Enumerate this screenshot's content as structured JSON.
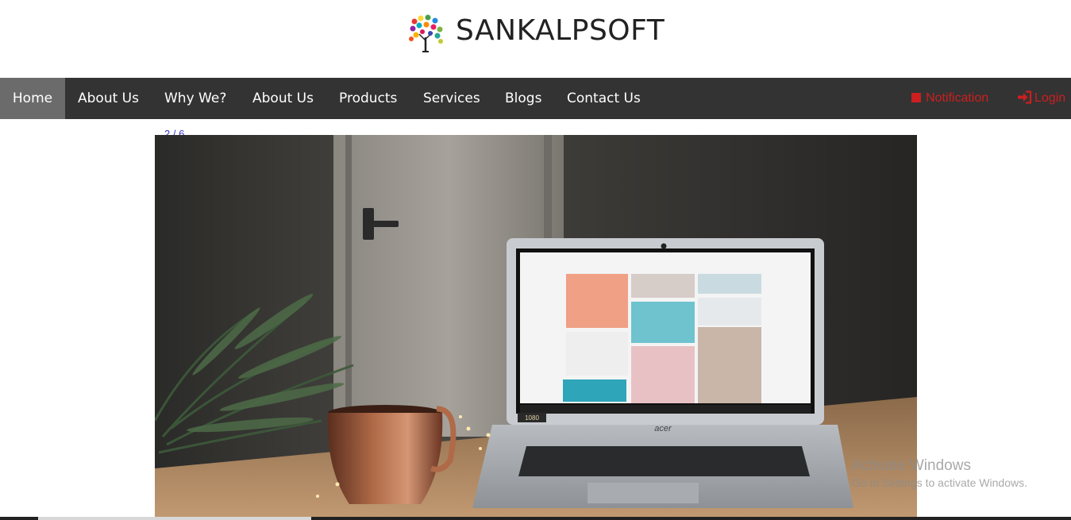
{
  "brand": {
    "name": "SANKALPSOFT",
    "logo_icon": "colorful-tree-icon"
  },
  "nav": {
    "items": [
      {
        "label": "Home",
        "active": true
      },
      {
        "label": "About Us"
      },
      {
        "label": "Why We?"
      },
      {
        "label": "About Us"
      },
      {
        "label": "Products"
      },
      {
        "label": "Services"
      },
      {
        "label": "Blogs"
      },
      {
        "label": "Contact Us"
      }
    ],
    "notification": {
      "label": "Notification",
      "icon": "square-icon"
    },
    "login": {
      "label": "Login",
      "icon": "sign-in-icon"
    },
    "accent_color": "#cc1f1f",
    "bar_color": "#333333"
  },
  "slider": {
    "counter": "2 / 6",
    "current": 2,
    "total": 6,
    "laptop_brand": "acer",
    "laptop_res": "1080"
  },
  "watermark": {
    "title": "Activate Windows",
    "subtitle": "Go to Settings to activate Windows."
  }
}
